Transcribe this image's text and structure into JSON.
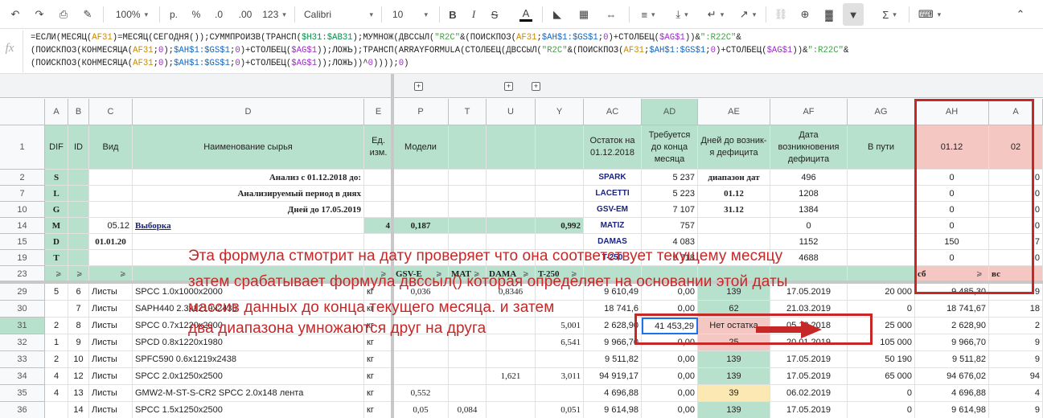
{
  "toolbar": {
    "zoom": "100%",
    "currency": "р.",
    "percent": "%",
    "dec_less": ".0",
    "dec_more": ".00",
    "more_formats": "123",
    "font": "Calibri",
    "font_size": "10"
  },
  "formula": {
    "fx": "fx"
  },
  "columns": [
    "A",
    "B",
    "C",
    "D",
    "E",
    "P",
    "T",
    "U",
    "Y",
    "AC",
    "AD",
    "AE",
    "AF",
    "AG",
    "AH",
    "A"
  ],
  "row_numbers": [
    "1",
    "2",
    "7",
    "10",
    "14",
    "15",
    "19",
    "23",
    "29",
    "30",
    "31",
    "32",
    "33",
    "34",
    "35",
    "36"
  ],
  "header_row": {
    "a": "DIF",
    "b": "ID",
    "c": "Вид",
    "d": "Наименование сырья",
    "e": "Ед. изм.",
    "p": "Модели",
    "ac": "Остаток на 01.12.2018",
    "ad": "Требуется до конца месяца",
    "ae": "Дней до возник-я дефицита",
    "af": "Дата возникновения дефицита",
    "ag": "В пути",
    "ah": "01.12",
    "ai": "02"
  },
  "rows": {
    "r2": {
      "a": "S",
      "d": "Анализ с 01.12.2018 до:",
      "ac": "SPARK",
      "ad": "5 237",
      "ae": "диапазон дат",
      "af": "496",
      "ah": "0",
      "ai": "0"
    },
    "r7": {
      "a": "L",
      "d": "Анализируемый период в днях",
      "ac": "LACETTI",
      "ad": "5 223",
      "ae": "01.12",
      "af": "1208",
      "ah": "0",
      "ai": "0"
    },
    "r10": {
      "a": "G",
      "d": "Дней до 17.05.2019",
      "ac": "GSV-EM",
      "ad": "7 107",
      "ae": "31.12",
      "af": "1384",
      "ah": "0",
      "ai": "0"
    },
    "r14": {
      "a": "M",
      "c": "05.12",
      "d": "Выборка",
      "e": "4",
      "p": "0,187",
      "y": "0,992",
      "ac": "MATIZ",
      "ad": "757",
      "af": "0",
      "ah": "0",
      "ai": "0"
    },
    "r15": {
      "a": "D",
      "c": "01.01.20",
      "ac": "DAMAS",
      "ad": "4 083",
      "af": "1152",
      "ah": "150",
      "ai": "7"
    },
    "r19": {
      "a": "T",
      "ac": "T-250",
      "ad": "9 718",
      "af": "4688",
      "ah": "0",
      "ai": "0"
    },
    "r23": {
      "p": "GSV-E",
      "t": "MAT",
      "u": "DAMA",
      "y": "T-250",
      "ah": "сб",
      "ai": "вс"
    },
    "r29": {
      "a": "5",
      "b": "6",
      "c": "Листы",
      "d": "SPCC 1.0x1000x2000",
      "e": "кг",
      "p": "0,036",
      "u": "0,8346",
      "ac": "9 610,49",
      "ad": "0,00",
      "ae": "139",
      "af": "17.05.2019",
      "ag": "20 000",
      "ah": "9 485,30",
      "ai": "9"
    },
    "r30": {
      "a": "",
      "b": "7",
      "c": "Листы",
      "d": "SAPH440 2.3x1219x2438",
      "e": "кг",
      "ac": "18 741,6",
      "ad": "0,00",
      "ae": "62",
      "af": "21.03.2019",
      "ag": "0",
      "ah": "18 741,67",
      "ai": "18"
    },
    "r31": {
      "a": "2",
      "b": "8",
      "c": "Листы",
      "d": "SPCC 0.7x1220x2000",
      "e": "кг",
      "y": "5,001",
      "ac": "2 628,90",
      "ad": "41 453,29",
      "ae": "Нет остатка",
      "af": "05.12.2018",
      "ag": "25 000",
      "ah": "2 628,90",
      "ai": "2"
    },
    "r32": {
      "a": "1",
      "b": "9",
      "c": "Листы",
      "d": "SPCD 0.8x1220x1980",
      "e": "кг",
      "y": "6,541",
      "ac": "9 966,70",
      "ad": "0,00",
      "ae": "25",
      "af": "20.01.2019",
      "ag": "105 000",
      "ah": "9 966,70",
      "ai": "9"
    },
    "r33": {
      "a": "2",
      "b": "10",
      "c": "Листы",
      "d": "SPFC590 0.6x1219x2438",
      "e": "кг",
      "ac": "9 511,82",
      "ad": "0,00",
      "ae": "139",
      "af": "17.05.2019",
      "ag": "50 190",
      "ah": "9 511,82",
      "ai": "9"
    },
    "r34": {
      "a": "4",
      "b": "12",
      "c": "Листы",
      "d": "SPCC 2.0x1250x2500",
      "e": "кг",
      "u": "1,621",
      "y": "3,011",
      "ac": "94 919,17",
      "ad": "0,00",
      "ae": "139",
      "af": "17.05.2019",
      "ag": "65 000",
      "ah": "94 676,02",
      "ai": "94"
    },
    "r35": {
      "a": "4",
      "b": "13",
      "c": "Листы",
      "d": "GMW2-M-ST-S-CR2 SPCC 2.0x148 лента",
      "e": "кг",
      "p": "0,552",
      "ac": "4 696,88",
      "ad": "0,00",
      "ae": "39",
      "af": "06.02.2019",
      "ag": "0",
      "ah": "4 696,88",
      "ai": "4"
    },
    "r36": {
      "a": "",
      "b": "14",
      "c": "Листы",
      "d": "SPCC 1.5x1250x2500",
      "e": "кг",
      "p": "0,05",
      "t": "0,084",
      "y": "0,051",
      "ac": "9 614,98",
      "ad": "0,00",
      "ae": "139",
      "af": "17.05.2019",
      "ag": "0",
      "ah": "9 614,98",
      "ai": "9"
    }
  },
  "annotation": [
    "Эта формула стмотрит на дату проверяет что она соответствует текущему месяцу",
    "затем срабатывает формула двссыл() которая определяет на основании этой даты",
    "массив данных до конца текущего месяца. и затем",
    "два диапазона умножаются друг на друга"
  ],
  "colors": {
    "header_green": "#b7e1cd",
    "pink": "#f4c7c3",
    "yellow": "#fce8b2",
    "red_annotation": "#c62828",
    "blue_model": "#1a237e"
  }
}
